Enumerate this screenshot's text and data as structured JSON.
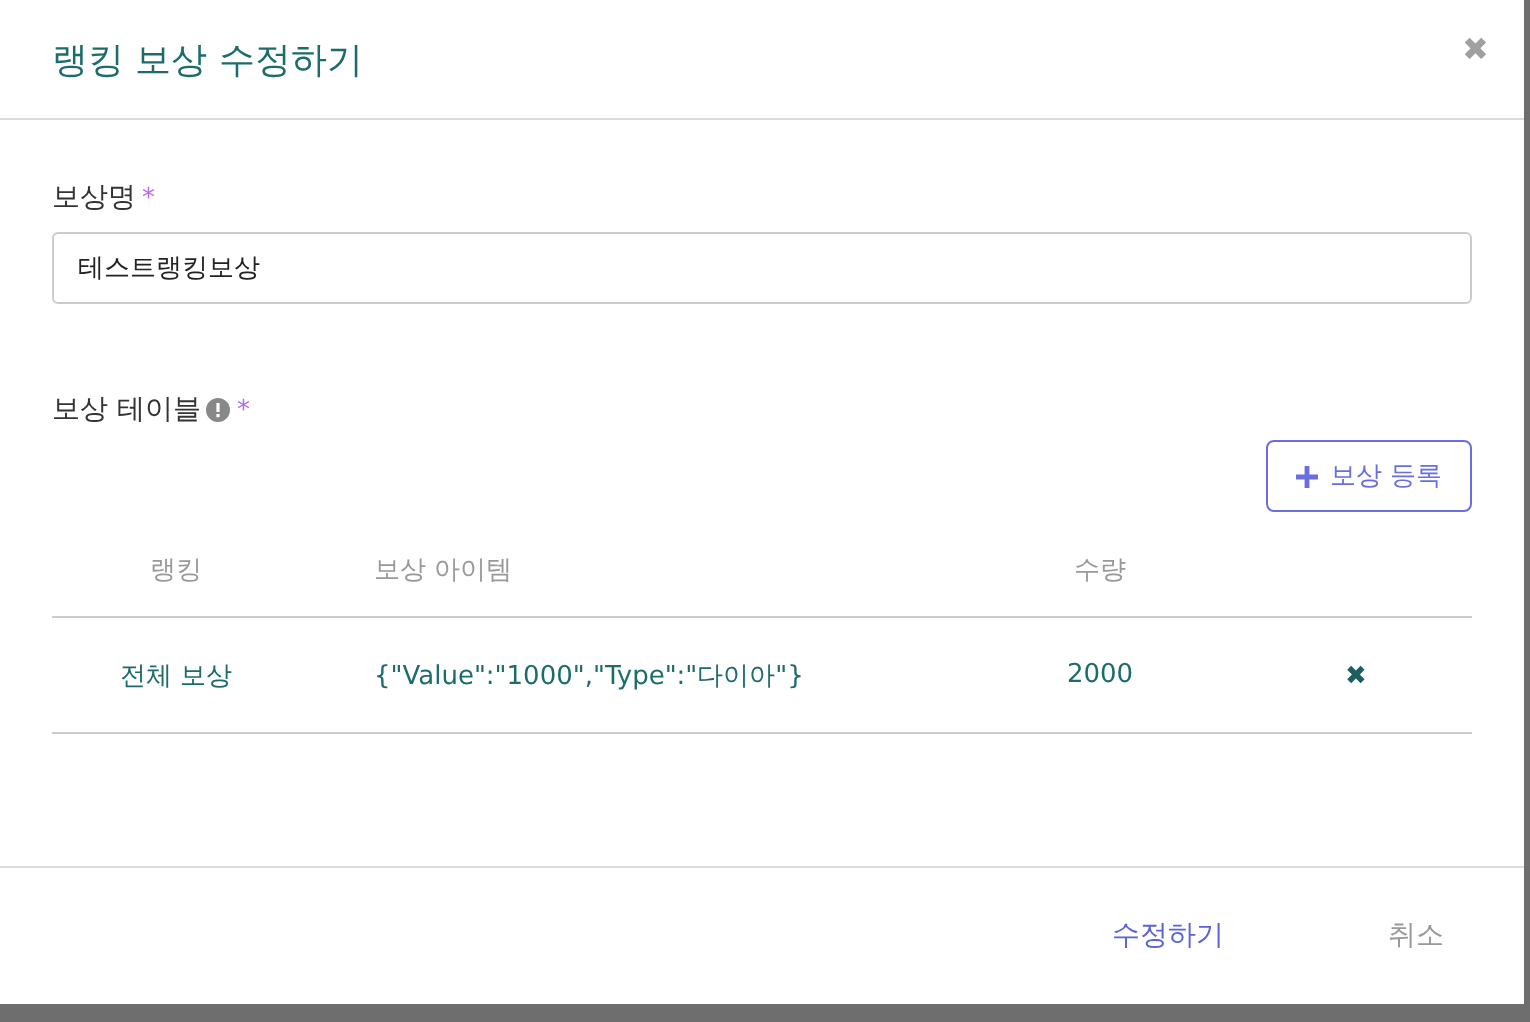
{
  "dialog": {
    "title": "랭킹 보상 수정하기",
    "close": "✖"
  },
  "name_field": {
    "label": "보상명",
    "required_mark": "*",
    "value": "테스트랭킹보상"
  },
  "reward_table": {
    "label": "보상 테이블",
    "required_mark": "*",
    "add_button": "보상 등록",
    "columns": [
      "랭킹",
      "보상 아이템",
      "수량"
    ],
    "rows": [
      {
        "ranking": "전체 보상",
        "item": "{\"Value\":\"1000\",\"Type\":\"다이아\"}",
        "quantity": "2000",
        "delete": "✖"
      }
    ]
  },
  "footer": {
    "buttons": [
      {
        "label": "수정하기",
        "kind": "primary"
      },
      {
        "label": "취소",
        "kind": "secondary"
      }
    ]
  }
}
